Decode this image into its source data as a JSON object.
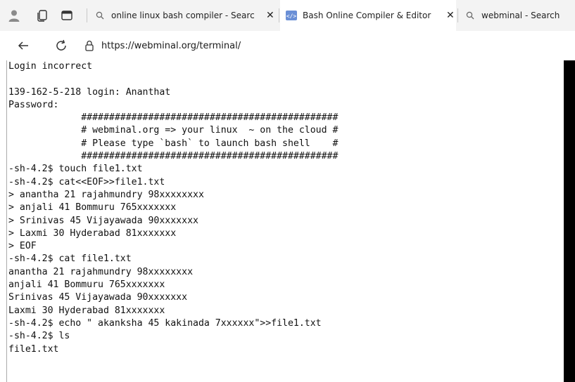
{
  "browser": {
    "tabs": [
      {
        "label": "online linux bash compiler - Searc",
        "favicon": "search-icon"
      },
      {
        "label": "Bash Online Compiler & Editor",
        "favicon": "code-icon"
      },
      {
        "label": "webminal - Search",
        "favicon": "search-icon"
      }
    ],
    "url": "https://webminal.org/terminal/"
  },
  "terminal": {
    "lines": [
      "Login incorrect",
      "",
      "139-162-5-218 login: Ananthat",
      "Password:",
      "             ##############################################",
      "             # webminal.org => your linux  ~ on the cloud #",
      "             # Please type `bash` to launch bash shell    #",
      "             ##############################################",
      "-sh-4.2$ touch file1.txt",
      "-sh-4.2$ cat<<EOF>>file1.txt",
      "> anantha 21 rajahmundry 98xxxxxxxx",
      "> anjali 41 Bommuru 765xxxxxxx",
      "> Srinivas 45 Vijayawada 90xxxxxxx",
      "> Laxmi 30 Hyderabad 81xxxxxxx",
      "> EOF",
      "-sh-4.2$ cat file1.txt",
      "anantha 21 rajahmundry 98xxxxxxxx",
      "anjali 41 Bommuru 765xxxxxxx",
      "Srinivas 45 Vijayawada 90xxxxxxx",
      "Laxmi 30 Hyderabad 81xxxxxxx",
      "-sh-4.2$ echo \" akanksha 45 kakinada 7xxxxxx\">>file1.txt",
      "-sh-4.2$ ls",
      "file1.txt"
    ]
  }
}
